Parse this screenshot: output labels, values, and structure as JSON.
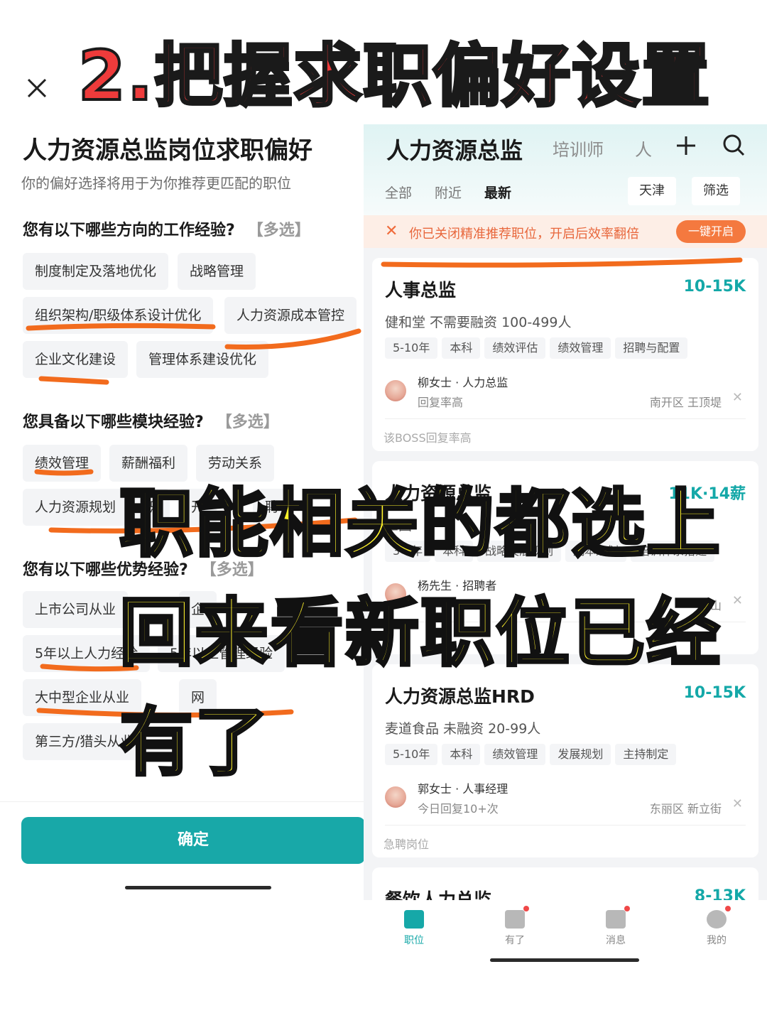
{
  "headline": "2.把握求职偏好设置",
  "left_panel": {
    "title": "人力资源总监岗位求职偏好",
    "subtitle": "你的偏好选择将用于为你推荐更匹配的职位",
    "sections": [
      {
        "question": "您有以下哪些方向的工作经验?",
        "multi": "【多选】",
        "tags": [
          "制度制定及落地优化",
          "战略管理",
          "组织架构/职级体系设计优化",
          "人力资源成本管控",
          "企业文化建设",
          "管理体系建设优化"
        ]
      },
      {
        "question": "您具备以下哪些模块经验?",
        "multi": "【多选】",
        "tags": [
          "绩效管理",
          "薪酬福利",
          "劳动关系",
          "人力资源规划",
          "职",
          "开",
          "聘"
        ]
      },
      {
        "question": "您有以下哪些优势经验?",
        "multi": "【多选】",
        "tags": [
          "上市公司从业",
          "企",
          "5年以上人力经验",
          "5年以上管理经验",
          "大中型企业从业",
          "网",
          "第三方/猎头从业"
        ]
      }
    ],
    "confirm_label": "确定"
  },
  "right_panel": {
    "header": {
      "title": "人力资源总监",
      "tab2": "培训师",
      "tab3": "人",
      "plus_icon": "plus-icon",
      "search_icon": "search-icon"
    },
    "filters": {
      "tabs": [
        "全部",
        "附近",
        "最新"
      ],
      "active_tab": "最新",
      "city": "天津",
      "filter": "筛选"
    },
    "notice": {
      "text": "你已关闭精准推荐职位，开启后效率翻倍",
      "button": "一键开启",
      "close_icon": "close-icon"
    },
    "jobs": [
      {
        "title": "人事总监",
        "salary": "10-15K",
        "company": "健和堂  不需要融资  100-499人",
        "tags": [
          "5-10年",
          "本科",
          "绩效评估",
          "绩效管理",
          "招聘与配置"
        ],
        "recruiter": "柳女士 · 人力总监",
        "reply": "回复率高",
        "location": "南开区  王顶堤",
        "footer": "该BOSS回复率高"
      },
      {
        "title": "人力资源总监",
        "salary": "11K·14薪",
        "company": "三国",
        "tags": [
          "3-5年",
          "本科",
          "战略发展规划",
          "成本规划",
          "培训体系搭建"
        ],
        "recruiter": "杨先生 · 招聘者",
        "reply": "",
        "location": "山",
        "footer": ""
      },
      {
        "title": "人力资源总监HRD",
        "salary": "10-15K",
        "company": "麦道食品  未融资  20-99人",
        "tags": [
          "5-10年",
          "本科",
          "绩效管理",
          "发展规划",
          "主持制定"
        ],
        "recruiter": "郭女士 · 人事经理",
        "reply": "今日回复10+次",
        "location": "东丽区  新立街",
        "footer": "急聘岗位"
      },
      {
        "title": "餐饮人力总监",
        "salary": "8-13K"
      }
    ],
    "tabbar": [
      {
        "label": "职位",
        "icon": "briefcase-icon",
        "active": true
      },
      {
        "label": "有了",
        "icon": "book-icon",
        "active": false
      },
      {
        "label": "消息",
        "icon": "message-icon",
        "active": false
      },
      {
        "label": "我的",
        "icon": "profile-icon",
        "active": false
      }
    ]
  },
  "overlay": {
    "line1": "职能相关的都选上",
    "line2": "回来看新职位已经",
    "line3": "有了"
  },
  "colors": {
    "headline_red": "#ee3b3b",
    "accent_teal": "#18a8a8",
    "notice_orange": "#f4793f",
    "overlay_yellow": "#fff22b",
    "marker_orange": "#f26b1d"
  }
}
